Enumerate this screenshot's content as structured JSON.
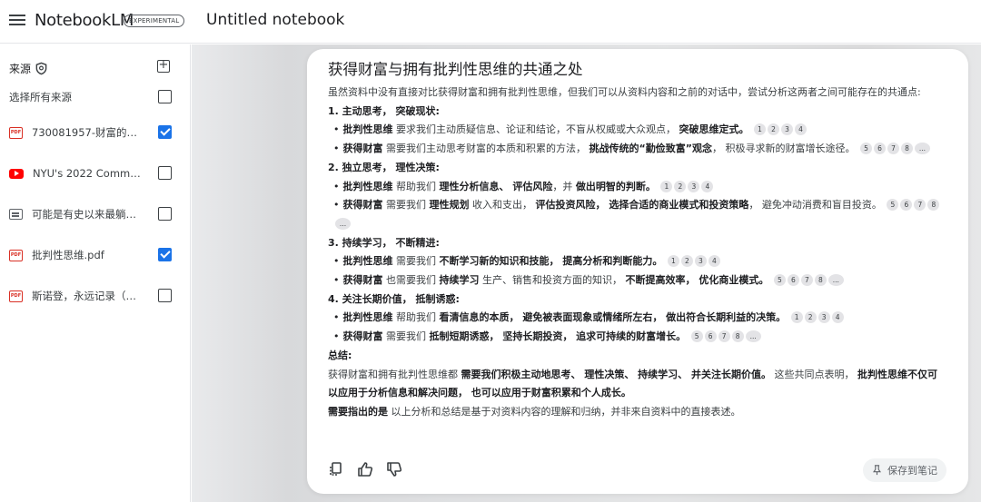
{
  "header": {
    "brand": "NotebookLM",
    "badge": "EXPERIMENTAL",
    "notebook_title": "Untitled notebook"
  },
  "sidebar": {
    "sources_label": "来源",
    "select_all_label": "选择所有来源",
    "select_all_checked": false,
    "items": [
      {
        "type": "pdf",
        "icon": "pdf-icon",
        "label": "730081957-财富的真...",
        "checked": true
      },
      {
        "type": "youtube",
        "icon": "youtube-icon",
        "label": "NYU's 2022 Commenc...",
        "checked": false
      },
      {
        "type": "text",
        "icon": "text-doc-icon",
        "label": "可能是有史以来最躺平...",
        "checked": false
      },
      {
        "type": "pdf",
        "icon": "pdf-icon",
        "label": "批判性思维.pdf",
        "checked": true
      },
      {
        "type": "pdf",
        "icon": "pdf-icon",
        "label": "斯诺登，永远记录（未...",
        "checked": false
      }
    ]
  },
  "answer": {
    "title": "获得财富与拥有批判性思维的共通之处",
    "intro": "虽然资料中没有直接对比获得财富和拥有批判性思维，但我们可以从资料内容和之前的对话中，尝试分析这两者之间可能存在的共通点:",
    "s1_head": "1. 主动思考， 突破现状:",
    "s1_b1_lead": "批判性思维",
    "s1_b1_text": " 要求我们主动质疑信息、论证和结论，不盲从权威或大众观点， ",
    "s1_b1_bold": "突破思维定式。",
    "s1_b2_lead": "获得财富",
    "s1_b2_text": " 需要我们主动思考财富的本质和积累的方法， ",
    "s1_b2_bold": "挑战传统的“勤俭致富”观念",
    "s1_b2_tail": "， 积极寻求新的财富增长途径。",
    "s2_head": "2. 独立思考， 理性决策:",
    "s2_b1_lead": "批判性思维",
    "s2_b1_text": " 帮助我们 ",
    "s2_b1_bold1": "理性分析信息、 评估风险",
    "s2_b1_mid": "，并 ",
    "s2_b1_bold2": "做出明智的判断。",
    "s2_b2_lead": "获得财富",
    "s2_b2_text": " 需要我们 ",
    "s2_b2_bold1": "理性规划",
    "s2_b2_mid": " 收入和支出， ",
    "s2_b2_bold2": "评估投资风险， 选择合适的商业模式和投资策略",
    "s2_b2_tail": "， 避免冲动消费和盲目投资。",
    "s3_head": "3. 持续学习， 不断精进:",
    "s3_b1_lead": "批判性思维",
    "s3_b1_text": " 需要我们 ",
    "s3_b1_bold": "不断学习新的知识和技能， 提高分析和判断能力。",
    "s3_b2_lead": "获得财富",
    "s3_b2_text": " 也需要我们 ",
    "s3_b2_bold1": "持续学习",
    "s3_b2_mid": " 生产、销售和投资方面的知识， ",
    "s3_b2_bold2": "不断提高效率， 优化商业模式。",
    "s4_head": "4. 关注长期价值， 抵制诱惑:",
    "s4_b1_lead": "批判性思维",
    "s4_b1_text": " 帮助我们 ",
    "s4_b1_bold": "看清信息的本质， 避免被表面现象或情绪所左右， 做出符合长期利益的决策。",
    "s4_b2_lead": "获得财富",
    "s4_b2_text": " 需要我们 ",
    "s4_b2_bold": "抵制短期诱惑， 坚持长期投资， 追求可持续的财富增长。",
    "summary_head": "总结:",
    "summary_text1": "获得财富和拥有批判性思维都 ",
    "summary_bold1": "需要我们积极主动地思考、 理性决策、 持续学习、 并关注长期价值。",
    "summary_text2": " 这些共同点表明， ",
    "summary_bold2": "批判性思维不仅可以应用于分析信息和解决问题， 也可以应用于财富积累和个人成长。",
    "note_bold": "需要指出的是",
    "note_text": " 以上分析和总结是基于对资料内容的理解和归纳，并非来自资料中的直接表述。"
  },
  "citations": {
    "c1": "1",
    "c2": "2",
    "c3": "3",
    "c4": "4",
    "c5": "5",
    "c6": "6",
    "c7": "7",
    "c8": "8",
    "more": "..."
  },
  "actions": {
    "copy_icon": "copy-icon",
    "like_icon": "thumbs-up-icon",
    "dislike_icon": "thumbs-down-icon",
    "save_note_label": "保存到笔记",
    "pin_icon": "pin-icon"
  },
  "colors": {
    "accent": "#1a73e8",
    "pdf_red": "#d93025",
    "youtube_red": "#ff0000"
  }
}
